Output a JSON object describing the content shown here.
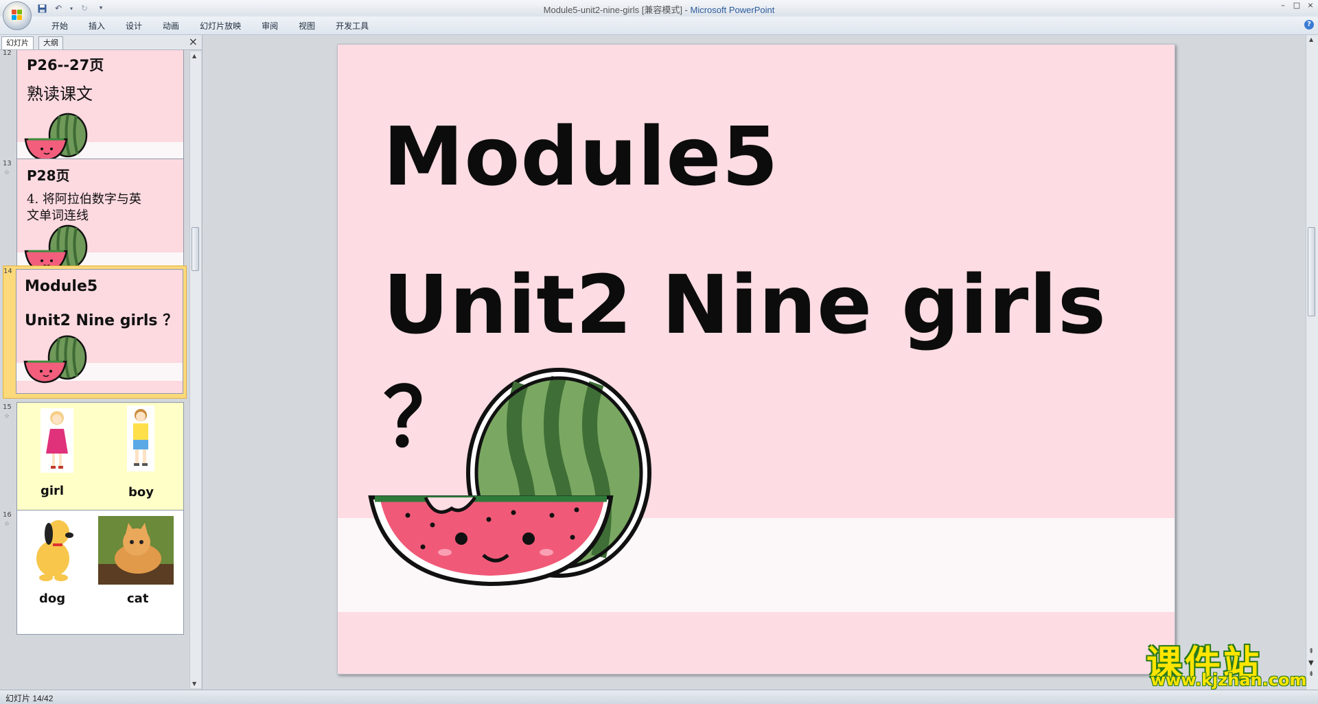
{
  "window": {
    "title_doc": "Module5-unit2-nine-girls [兼容模式] - ",
    "title_app": "Microsoft PowerPoint",
    "controls": [
      "–",
      "□",
      "×"
    ]
  },
  "ribbon": {
    "tabs": [
      "开始",
      "插入",
      "设计",
      "动画",
      "幻灯片放映",
      "审阅",
      "视图",
      "开发工具"
    ]
  },
  "left_pane": {
    "tabs": [
      "幻灯片",
      "大纲"
    ],
    "close": "×",
    "slides": [
      {
        "number": "12",
        "title": "P26--27页",
        "body": "熟读课文"
      },
      {
        "number": "13",
        "title": "P28页",
        "body_lines": [
          "4. 将阿拉伯数字与英",
          "文单词连线"
        ]
      },
      {
        "number": "14",
        "title": "Module5",
        "body": "Unit2 Nine girls ？"
      },
      {
        "number": "15",
        "captions": [
          "girl",
          "boy"
        ]
      },
      {
        "number": "16",
        "captions": [
          "dog",
          "cat"
        ]
      }
    ]
  },
  "slide": {
    "title": "Module5",
    "subtitle": "Unit2 Nine girls ？"
  },
  "status": {
    "slide_counter": "幻灯片 14/42"
  },
  "watermark": {
    "cn": "课件站",
    "url": "www.kjzhan.com"
  },
  "colors": {
    "slide_bg": "#fddce3",
    "selected_thumb": "#fcd97a",
    "accent": "#2c5b9c"
  }
}
